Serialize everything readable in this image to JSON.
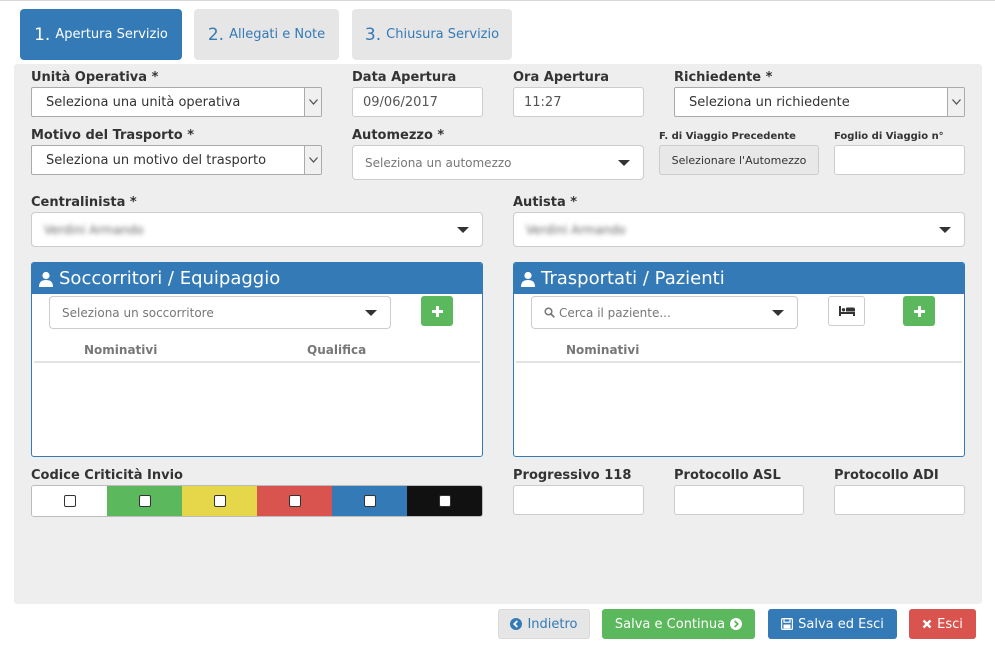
{
  "tabs": [
    {
      "num": "1.",
      "label": "Apertura Servizio"
    },
    {
      "num": "2.",
      "label": "Allegati e Note"
    },
    {
      "num": "3.",
      "label": "Chiusura Servizio"
    }
  ],
  "form": {
    "unita_operativa": {
      "label": "Unità Operativa *",
      "value": "Seleziona una unità operativa"
    },
    "data_apertura": {
      "label": "Data Apertura",
      "value": "09/06/2017"
    },
    "ora_apertura": {
      "label": "Ora Apertura",
      "value": "11:27"
    },
    "richiedente": {
      "label": "Richiedente *",
      "value": "Seleziona un richiedente"
    },
    "motivo_trasporto": {
      "label": "Motivo del Trasporto *",
      "value": "Seleziona un motivo del trasporto"
    },
    "automezzo": {
      "label": "Automezzo *",
      "placeholder": "Seleziona un automezzo"
    },
    "f_viaggio_precedente": {
      "label": "F. di Viaggio Precedente",
      "button": "Selezionare l'Automezzo"
    },
    "foglio_viaggio": {
      "label": "Foglio di Viaggio n°",
      "value": ""
    },
    "centralinista": {
      "label": "Centralinista *",
      "value": "Verdini Armando"
    },
    "autista": {
      "label": "Autista *",
      "value": "Verdini Armando"
    }
  },
  "soccorritori": {
    "title": "Soccorritori / Equipaggio",
    "placeholder": "Seleziona un soccorritore",
    "columns": [
      "Nominativi",
      "Qualifica"
    ],
    "rows": []
  },
  "trasportati": {
    "title": "Trasportati / Pazienti",
    "placeholder": "Cerca il paziente...",
    "columns": [
      "Nominativi"
    ],
    "rows": []
  },
  "criticita": {
    "label": "Codice Criticità Invio",
    "colors": [
      "#ffffff",
      "#5cb85c",
      "#e5d64a",
      "#d9534f",
      "#337ab7",
      "#111111"
    ]
  },
  "progressivo_118": {
    "label": "Progressivo 118",
    "value": ""
  },
  "protocollo_asl": {
    "label": "Protocollo ASL",
    "value": ""
  },
  "protocollo_adi": {
    "label": "Protocollo ADI",
    "value": ""
  },
  "footer": {
    "indietro": "Indietro",
    "salva_continua": "Salva e Continua",
    "salva_esci": "Salva ed Esci",
    "esci": "Esci"
  }
}
